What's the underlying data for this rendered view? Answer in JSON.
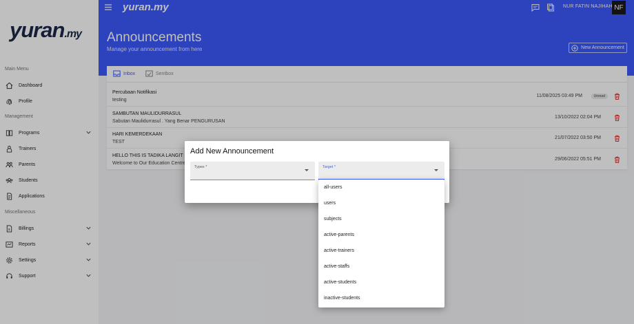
{
  "app": {
    "logo_text": "yuran",
    "logo_suffix": ".my",
    "top_logo": "yuran.my"
  },
  "user": {
    "name": "NUR FATIN NAJIHAH",
    "initials": "NF"
  },
  "sidebar": {
    "sections": [
      "Main Menu",
      "Management",
      "Miscellaneous"
    ],
    "items": [
      {
        "label": "Dashboard",
        "icon": "home-icon"
      },
      {
        "label": "Profile",
        "icon": "fingerprint-icon"
      },
      {
        "label": "Programs",
        "icon": "book-icon"
      },
      {
        "label": "Trainers",
        "icon": "trainer-icon"
      },
      {
        "label": "Parents",
        "icon": "parents-icon"
      },
      {
        "label": "Students",
        "icon": "students-icon"
      },
      {
        "label": "Applications",
        "icon": "document-icon"
      },
      {
        "label": "Billings",
        "icon": "invoice-icon"
      },
      {
        "label": "Reports",
        "icon": "report-icon"
      },
      {
        "label": "Settings",
        "icon": "gear-icon"
      },
      {
        "label": "Support",
        "icon": "support-icon"
      }
    ]
  },
  "header": {
    "title": "Announcements",
    "subtitle": "Manage your announcement from here",
    "new_button": "New Announcement"
  },
  "tabs": [
    {
      "label": "Inbox"
    },
    {
      "label": "Sentbox"
    }
  ],
  "announcements": [
    {
      "title": "Percubaan Notifikasi",
      "body": "testing",
      "date": "11/08/2025 03:49 PM",
      "badge": "Unread"
    },
    {
      "title": "SAMBUTAN MAULIDURRASUL",
      "body": "Sabutan Maulidurrasul . Yang Benar PENGURUSAN",
      "date": "13/10/2022 02:04 PM"
    },
    {
      "title": "HARI KEMERDEKAAN",
      "body": "TEST",
      "date": "21/07/2022 03:50 PM"
    },
    {
      "title": "HELLO THIS IS TADIKA LANGIT CEN",
      "body": "Welcome to Our Education Centre t",
      "date": "29/06/2022 05:51 PM"
    }
  ],
  "dialog": {
    "title": "Add New Announcement",
    "types_label": "Types *",
    "target_label": "Target *",
    "target_options": [
      "all-users",
      "users",
      "subjects",
      "active-parents",
      "active-trainers",
      "active-staffs",
      "active-students",
      "inactive-students"
    ]
  },
  "colors": {
    "primary": "#3d5afe",
    "danger": "#e53935"
  }
}
